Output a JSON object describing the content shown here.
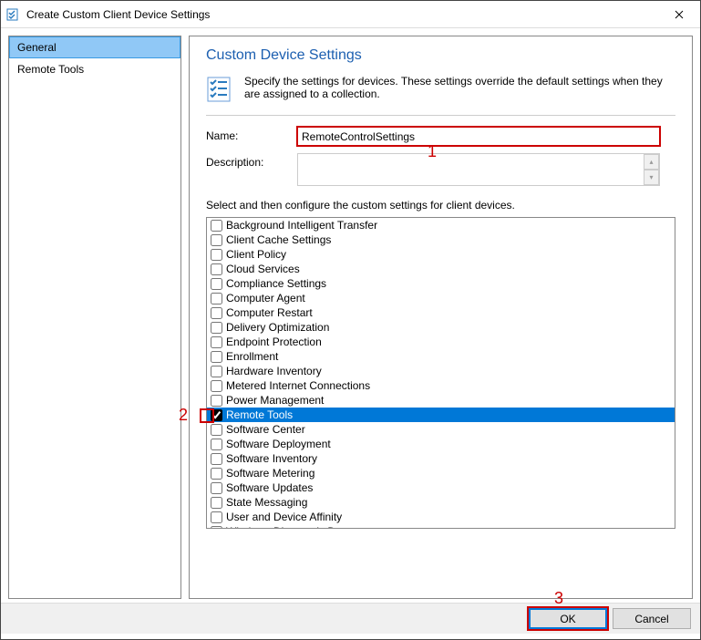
{
  "window": {
    "title": "Create Custom Client Device Settings"
  },
  "sidebar": {
    "items": [
      {
        "label": "General",
        "selected": true
      },
      {
        "label": "Remote Tools",
        "selected": false
      }
    ]
  },
  "main": {
    "heading": "Custom Device Settings",
    "intro": "Specify the settings for devices. These settings override the default settings when they are assigned to a collection.",
    "name_label": "Name:",
    "name_value": "RemoteControlSettings",
    "desc_label": "Description:",
    "desc_value": "",
    "list_label": "Select and then configure the custom settings for client devices.",
    "settings": [
      {
        "label": "Background Intelligent Transfer",
        "checked": false,
        "highlight": false
      },
      {
        "label": "Client Cache Settings",
        "checked": false,
        "highlight": false
      },
      {
        "label": "Client Policy",
        "checked": false,
        "highlight": false
      },
      {
        "label": "Cloud Services",
        "checked": false,
        "highlight": false
      },
      {
        "label": "Compliance Settings",
        "checked": false,
        "highlight": false
      },
      {
        "label": "Computer Agent",
        "checked": false,
        "highlight": false
      },
      {
        "label": "Computer Restart",
        "checked": false,
        "highlight": false
      },
      {
        "label": "Delivery Optimization",
        "checked": false,
        "highlight": false
      },
      {
        "label": "Endpoint Protection",
        "checked": false,
        "highlight": false
      },
      {
        "label": "Enrollment",
        "checked": false,
        "highlight": false
      },
      {
        "label": "Hardware Inventory",
        "checked": false,
        "highlight": false
      },
      {
        "label": "Metered Internet Connections",
        "checked": false,
        "highlight": false
      },
      {
        "label": "Power Management",
        "checked": false,
        "highlight": false
      },
      {
        "label": "Remote Tools",
        "checked": true,
        "highlight": true
      },
      {
        "label": "Software Center",
        "checked": false,
        "highlight": false
      },
      {
        "label": "Software Deployment",
        "checked": false,
        "highlight": false
      },
      {
        "label": "Software Inventory",
        "checked": false,
        "highlight": false
      },
      {
        "label": "Software Metering",
        "checked": false,
        "highlight": false
      },
      {
        "label": "Software Updates",
        "checked": false,
        "highlight": false
      },
      {
        "label": "State Messaging",
        "checked": false,
        "highlight": false
      },
      {
        "label": "User and Device Affinity",
        "checked": false,
        "highlight": false
      },
      {
        "label": "Windows Diagnostic Data",
        "checked": false,
        "highlight": false
      }
    ]
  },
  "buttons": {
    "ok": "OK",
    "cancel": "Cancel"
  },
  "annotations": {
    "a1": "1",
    "a2": "2",
    "a3": "3"
  }
}
